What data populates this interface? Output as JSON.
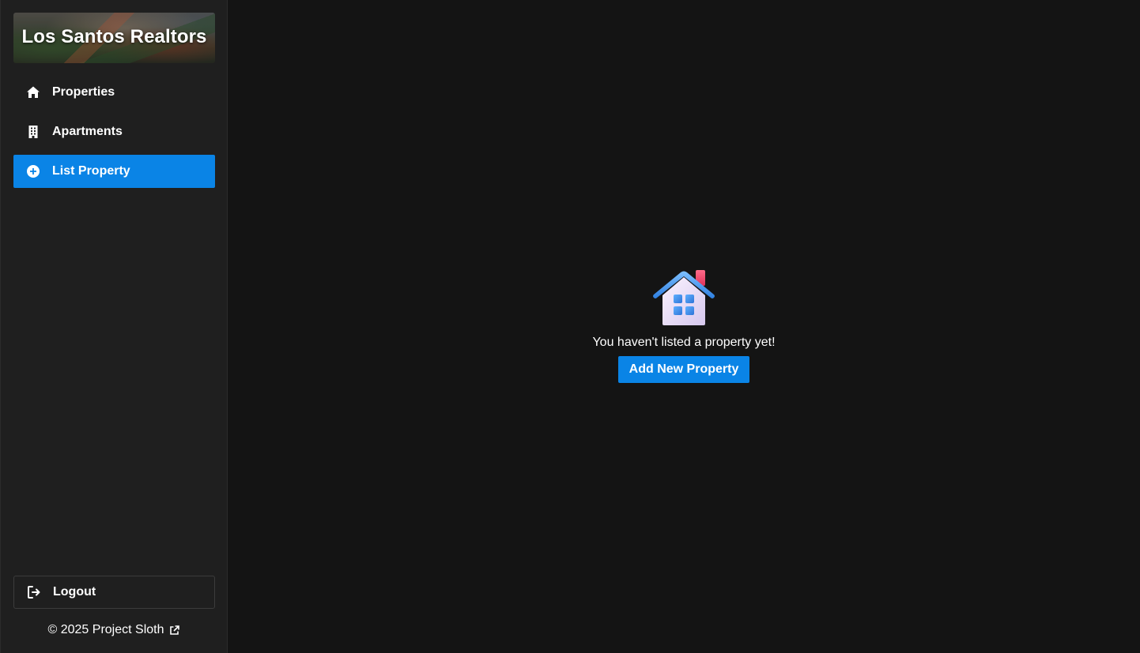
{
  "sidebar": {
    "brand": {
      "title": "Los Santos Realtors"
    },
    "nav": [
      {
        "label": "Properties",
        "icon": "home-icon",
        "active": false
      },
      {
        "label": "Apartments",
        "icon": "building-icon",
        "active": false
      },
      {
        "label": "List Property",
        "icon": "plus-circle-icon",
        "active": true
      }
    ],
    "logout": {
      "label": "Logout",
      "icon": "logout-icon"
    },
    "footer": {
      "text": "© 2025 Project Sloth",
      "icon": "external-link-icon"
    }
  },
  "main": {
    "empty_state": {
      "icon": "house-icon",
      "message": "You haven't listed a property yet!",
      "button_label": "Add New Property"
    }
  },
  "colors": {
    "accent": "#0a84e6",
    "sidebar_bg": "#1f1f1f",
    "main_bg": "#141414",
    "text": "#ffffff"
  }
}
